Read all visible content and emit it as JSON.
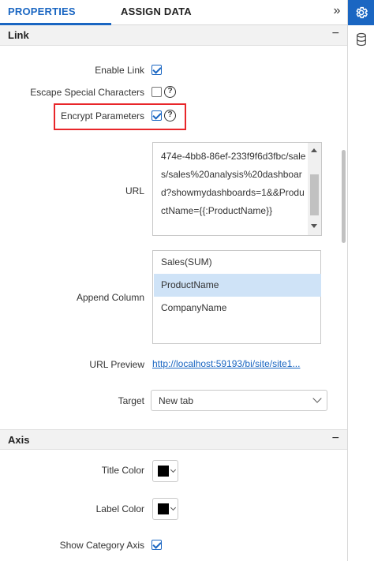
{
  "tabs": {
    "properties": "PROPERTIES",
    "assign_data": "ASSIGN DATA"
  },
  "icons": {
    "collapse": "double-chevron-right-icon",
    "settings": "gear-icon",
    "data": "database-icon"
  },
  "colors": {
    "accent": "#1a66c2",
    "highlight": "#e8262a",
    "selected_row": "#cfe3f7"
  },
  "link_section": {
    "title": "Link",
    "enable_link": {
      "label": "Enable Link",
      "checked": true
    },
    "escape_special": {
      "label": "Escape Special Characters",
      "checked": false
    },
    "encrypt_params": {
      "label": "Encrypt Parameters",
      "checked": true
    },
    "url": {
      "label": "URL",
      "value": "474e-4bb8-86ef-233f9f6d3fbc/sales/sales%20analysis%20dashboard?showmydashboards=1&&ProductName={{:ProductName}}"
    },
    "append_column": {
      "label": "Append Column",
      "options": [
        "Sales(SUM)",
        "ProductName",
        "CompanyName"
      ],
      "selected": "ProductName"
    },
    "url_preview": {
      "label": "URL Preview",
      "value": "http://localhost:59193/bi/site/site1..."
    },
    "target": {
      "label": "Target",
      "value": "New tab"
    }
  },
  "axis_section": {
    "title": "Axis",
    "title_color": {
      "label": "Title Color",
      "value": "#000000"
    },
    "label_color": {
      "label": "Label Color",
      "value": "#000000"
    },
    "show_category_axis": {
      "label": "Show Category Axis",
      "checked": true
    }
  },
  "help_glyph": "?",
  "minus_glyph": "−",
  "collapse_glyph": "»"
}
